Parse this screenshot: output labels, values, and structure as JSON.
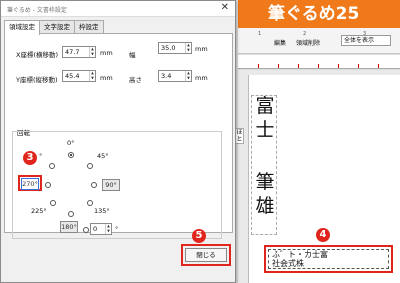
{
  "app": {
    "brand": "筆ぐるめ25",
    "toolbar_label_1": "編集",
    "toolbar_label_2": "領域削除",
    "view_select": "全体を表示",
    "ruler_nums": [
      "1",
      "2",
      "3"
    ]
  },
  "dialog": {
    "title": "筆ぐるめ - 文書枠設定",
    "close_glyph": "✕",
    "tabs": [
      "領域設定",
      "文字設定",
      "枠設定"
    ],
    "fields": {
      "x_label": "X座標(横移動)",
      "x_value": "47.7",
      "x_unit": "mm",
      "width_label": "幅",
      "width_value": "35.0",
      "width_unit": "mm",
      "y_label": "Y座標(縦移動)",
      "y_value": "45.4",
      "y_unit": "mm",
      "height_label": "高さ",
      "height_value": "3.4",
      "height_unit": "mm"
    },
    "rotation": {
      "group_label": "回転",
      "deg0": "0°",
      "deg45": "45°",
      "deg90": "90°",
      "deg135": "135°",
      "deg180": "180°",
      "deg225": "225°",
      "deg270": "270°",
      "deg315": "°",
      "custom_value": "0",
      "custom_unit": "°",
      "selected": "0°"
    },
    "close_label": "閉じる"
  },
  "markers": {
    "m3": "3",
    "m4": "4",
    "m5": "5"
  },
  "canvas": {
    "v_chars": [
      "富",
      "士",
      "",
      "筆",
      "雄"
    ],
    "small_v": "ほ\nと",
    "h_line1": "ふ゛ト・カ士富",
    "h_line2": "社会式株"
  }
}
